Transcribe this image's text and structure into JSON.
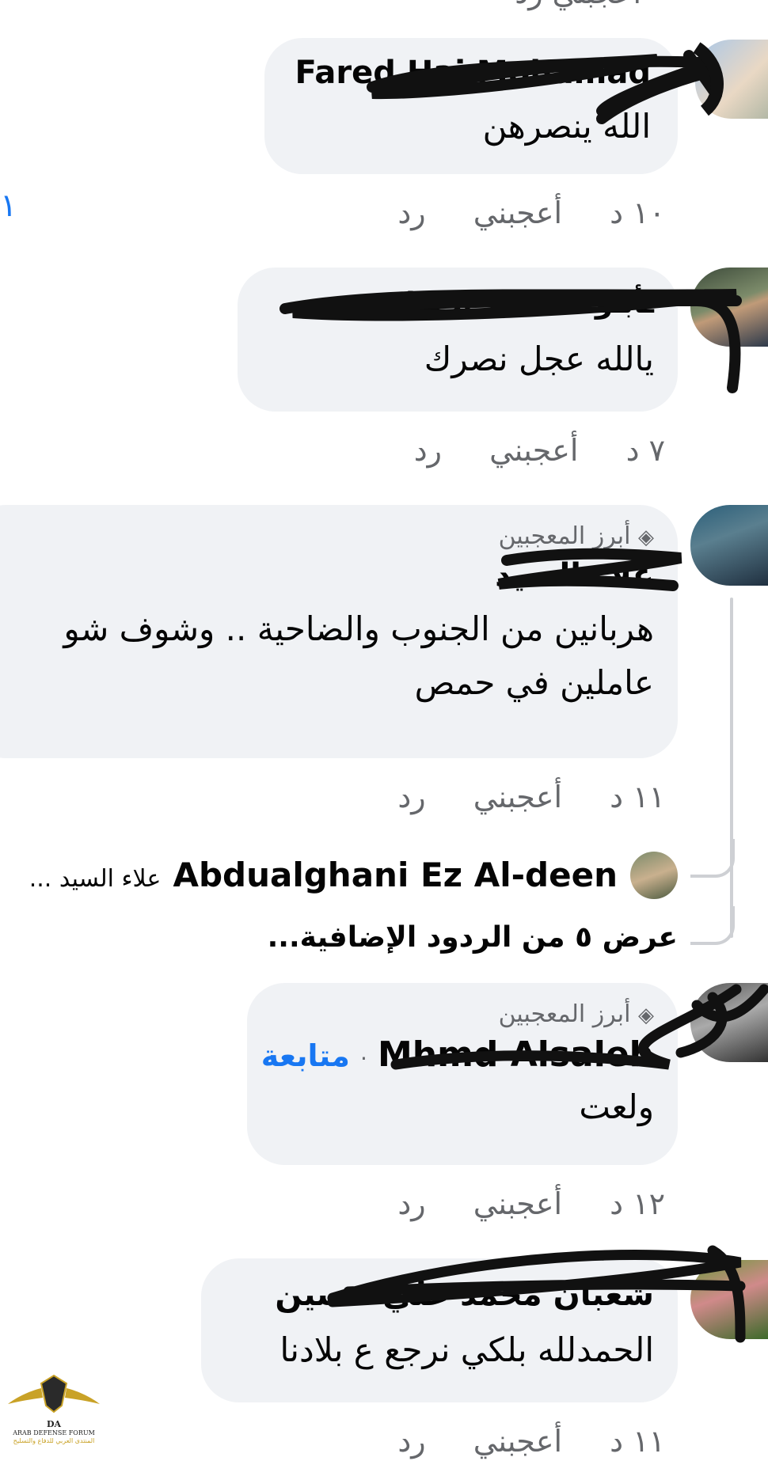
{
  "top_partial": "أعجبني  رد",
  "comments": [
    {
      "name": "Fared Haj Mohamad",
      "text": "الله ينصرهن",
      "time": "١٠ د",
      "like": "أعجبني",
      "reply": "رد"
    },
    {
      "name": "ـأبـو مـحـمـد الـعـلـي",
      "text": "يالله عجل نصرك",
      "time": "٧ د",
      "like": "أعجبني",
      "reply": "رد"
    },
    {
      "badge": "أبرز المعجبين",
      "name": "علاء السيد",
      "text": "هربانين من الجنوب والضاحية .. وشوف شو عاملين في حمص",
      "time": "١١ د",
      "like": "أعجبني",
      "reply": "رد",
      "reply_preview": {
        "name": "Abdualghani Ez Al-deen",
        "snippet": "علاء السيد ..."
      },
      "more_replies": "عرض ٥ من الردود الإضافية..."
    },
    {
      "badge": "أبرز المعجبين",
      "name": "Mhmd Alsaleh",
      "follow": "متابعة",
      "text": "ولعت",
      "time": "١٢ د",
      "like": "أعجبني",
      "reply": "رد"
    },
    {
      "name": "شعبان محمد علي حسين",
      "text": "الحمدلله بلكي نرجع ع بلادنا",
      "time": "١١ د",
      "like": "أعجبني",
      "reply": "رد"
    }
  ],
  "edge_text": "١",
  "watermark": {
    "title": "ARAB DEFENSE FORUM",
    "subtitle": "المنتدى العربي للدفاع والتسليح",
    "mark": "DA"
  },
  "colors": {
    "bubble": "#f0f2f5",
    "meta": "#65676b",
    "link": "#1877f2",
    "scribble": "#111111"
  }
}
